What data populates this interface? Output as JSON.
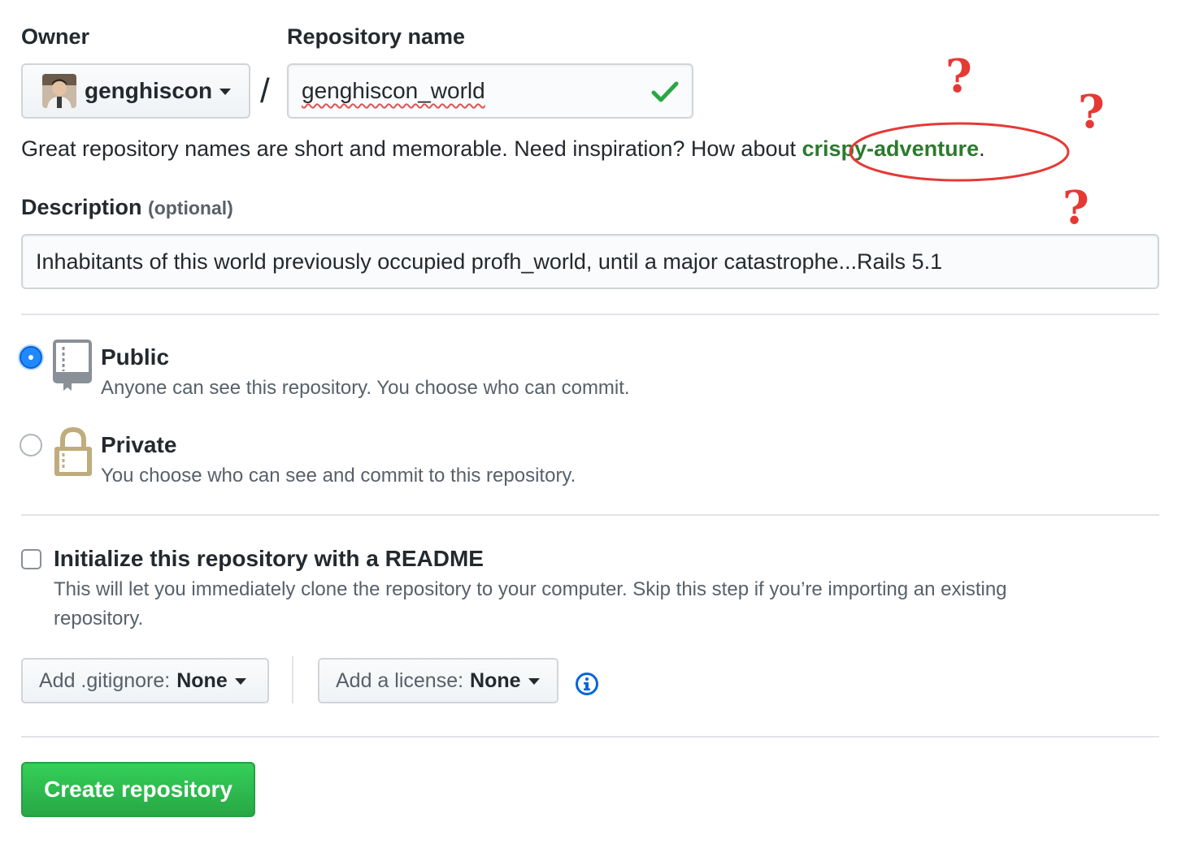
{
  "owner": {
    "label": "Owner",
    "name": "genghiscon"
  },
  "repo": {
    "label": "Repository name",
    "value": "genghiscon_world"
  },
  "hint": {
    "text": "Great repository names are short and memorable. Need inspiration? How about ",
    "suggestion": "crispy-adventure",
    "suffix": "."
  },
  "annotations": {
    "qmark": "?"
  },
  "description": {
    "label": "Description",
    "optional": "(optional)",
    "value": "Inhabitants of this world previously occupied profh_world, until a major catastrophe...Rails 5.1"
  },
  "visibility": {
    "public_title": "Public",
    "public_desc": "Anyone can see this repository. You choose who can commit.",
    "private_title": "Private",
    "private_desc": "You choose who can see and commit to this repository.",
    "selected": "public"
  },
  "readme": {
    "title": "Initialize this repository with a README",
    "desc_line1": "This will let you immediately clone the repository to your computer. Skip this step if you’re importing an existing",
    "desc_line2": "repository.",
    "checked": false
  },
  "gitignore": {
    "label": "Add .gitignore:",
    "value": "None"
  },
  "license": {
    "label": "Add a license:",
    "value": "None"
  },
  "submit": {
    "label": "Create repository"
  },
  "colors": {
    "accent": "#0366d6",
    "success": "#28a745",
    "annotation": "#e53935"
  },
  "icons": {
    "check": "check-icon",
    "public": "repo-book-icon",
    "private": "lock-icon",
    "info": "info-icon"
  }
}
